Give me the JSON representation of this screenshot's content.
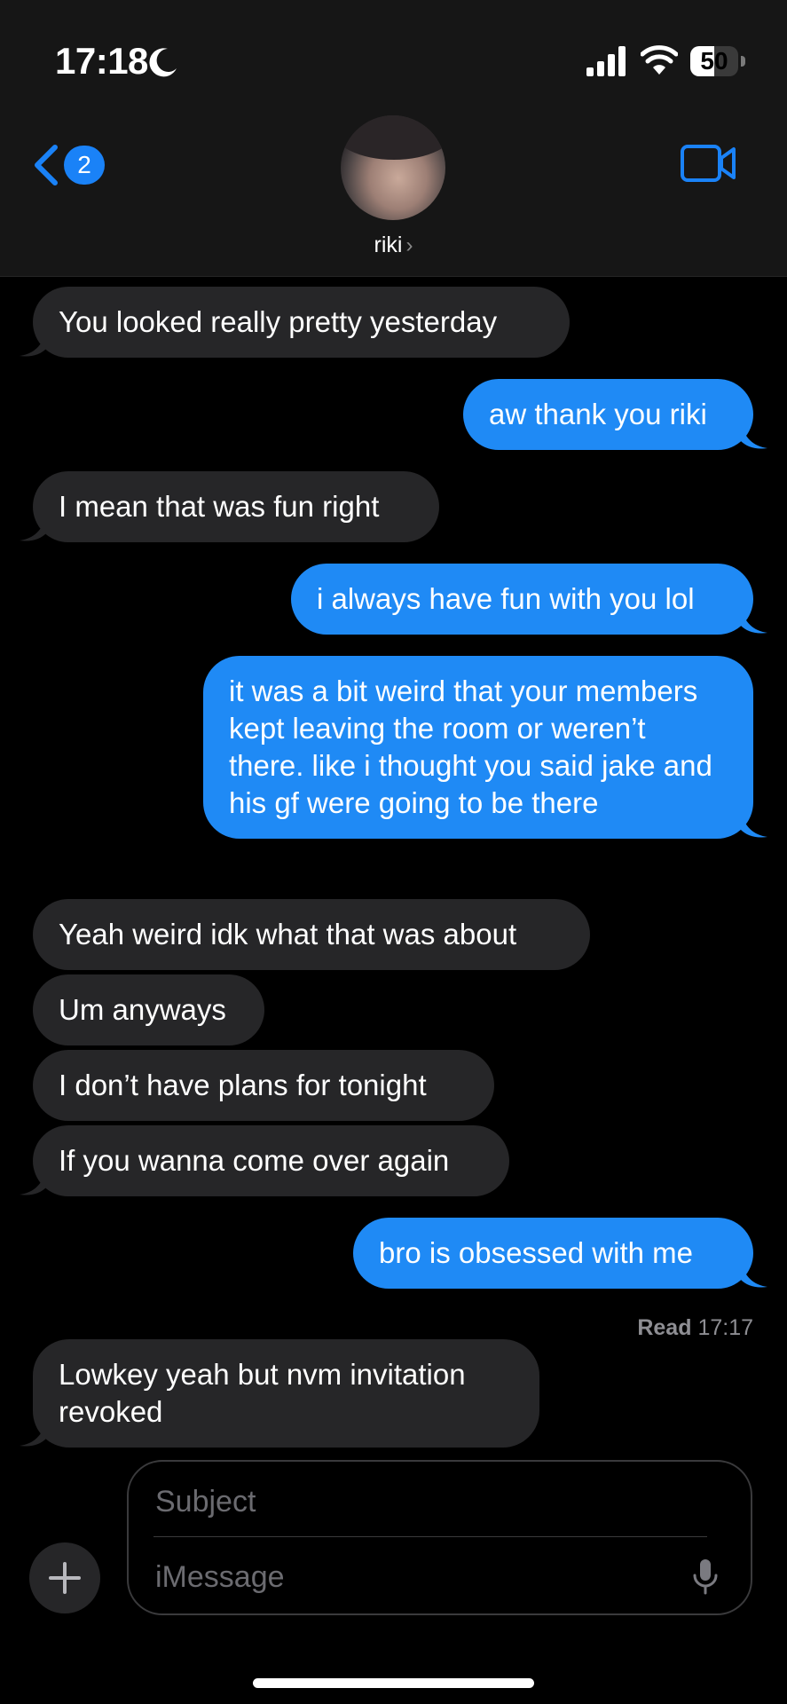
{
  "status_bar": {
    "time": "17:18",
    "battery_percent": "50",
    "battery_level": 0.5
  },
  "header": {
    "back_badge_count": "2",
    "contact_name": "riki",
    "icons": [
      "chevron-left-icon",
      "video-camera-icon",
      "chevron-right-icon"
    ]
  },
  "messages": [
    {
      "from": "them",
      "text": "You looked really pretty yesterday"
    },
    {
      "from": "me",
      "text": "aw thank you riki"
    },
    {
      "from": "them",
      "text": "I mean that was fun right"
    },
    {
      "from": "me",
      "text": "i always have fun with you lol"
    },
    {
      "from": "me",
      "text": "it was a bit weird that your members kept leaving the room or weren’t there. like i thought you said jake and his gf were going to be there"
    },
    {
      "from": "them",
      "text": "Yeah weird idk what that was about"
    },
    {
      "from": "them",
      "text": "Um anyways"
    },
    {
      "from": "them",
      "text": "I don’t have plans for tonight"
    },
    {
      "from": "them",
      "text": "If you wanna come over again"
    },
    {
      "from": "me",
      "text": "bro is obsessed with me"
    },
    {
      "from": "them",
      "text": "Lowkey yeah but nvm invitation revoked"
    }
  ],
  "read_receipt": {
    "label": "Read",
    "time": "17:17"
  },
  "composer": {
    "subject_placeholder": "Subject",
    "message_placeholder": "iMessage"
  },
  "colors": {
    "outgoing_bubble": "#1f8af5",
    "incoming_bubble": "#262628",
    "accent": "#1a82f7"
  }
}
